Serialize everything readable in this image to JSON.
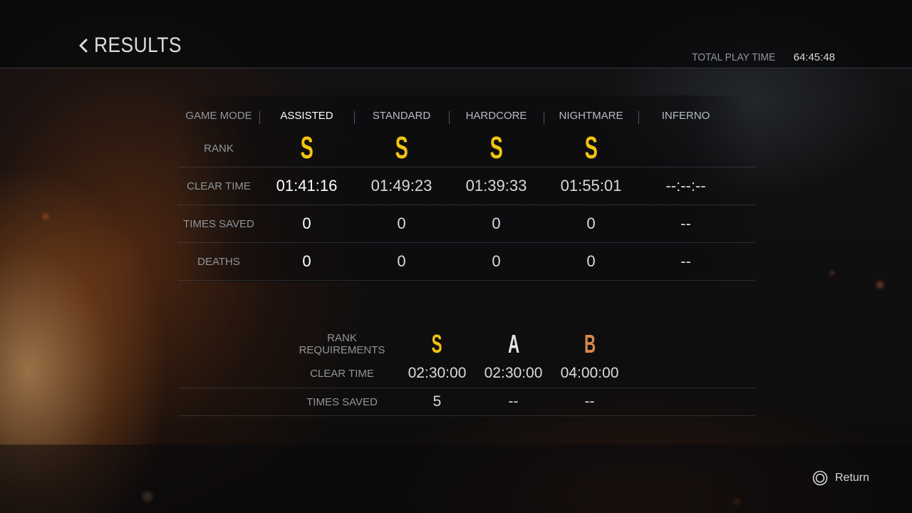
{
  "header": {
    "title": "RESULTS",
    "total_play_time_label": "TOTAL PLAY TIME",
    "total_play_time_value": "64:45:48"
  },
  "results_table": {
    "row_labels": {
      "game_mode": "GAME MODE",
      "rank": "RANK",
      "clear_time": "CLEAR TIME",
      "times_saved": "TIMES SAVED",
      "deaths": "DEATHS"
    },
    "modes": [
      {
        "name": "ASSISTED",
        "rank": "S",
        "clear_time": "01:41:16",
        "times_saved": "0",
        "deaths": "0",
        "selected": true
      },
      {
        "name": "STANDARD",
        "rank": "S",
        "clear_time": "01:49:23",
        "times_saved": "0",
        "deaths": "0",
        "selected": false
      },
      {
        "name": "HARDCORE",
        "rank": "S",
        "clear_time": "01:39:33",
        "times_saved": "0",
        "deaths": "0",
        "selected": false
      },
      {
        "name": "NIGHTMARE",
        "rank": "S",
        "clear_time": "01:55:01",
        "times_saved": "0",
        "deaths": "0",
        "selected": false
      },
      {
        "name": "INFERNO",
        "rank": "",
        "clear_time": "--:--:--",
        "times_saved": "--",
        "deaths": "--",
        "selected": false
      }
    ]
  },
  "rank_requirements": {
    "label": "RANK REQUIREMENTS",
    "ranks": [
      "S",
      "A",
      "B"
    ],
    "rank_colors": [
      "#f1c40f",
      "#e4e6e7",
      "#d9874d"
    ],
    "clear_time_label": "CLEAR TIME",
    "clear_time_values": [
      "02:30:00",
      "02:30:00",
      "04:00:00"
    ],
    "times_saved_label": "TIMES SAVED",
    "times_saved_values": [
      "5",
      "--",
      "--"
    ]
  },
  "footer": {
    "return_label": "Return",
    "return_icon": "circle-button-icon"
  },
  "colors": {
    "rank_gold": "#f1c40f",
    "rank_silver": "#e4e6e7",
    "rank_bronze": "#d9874d",
    "label_grey": "#8f9599"
  }
}
